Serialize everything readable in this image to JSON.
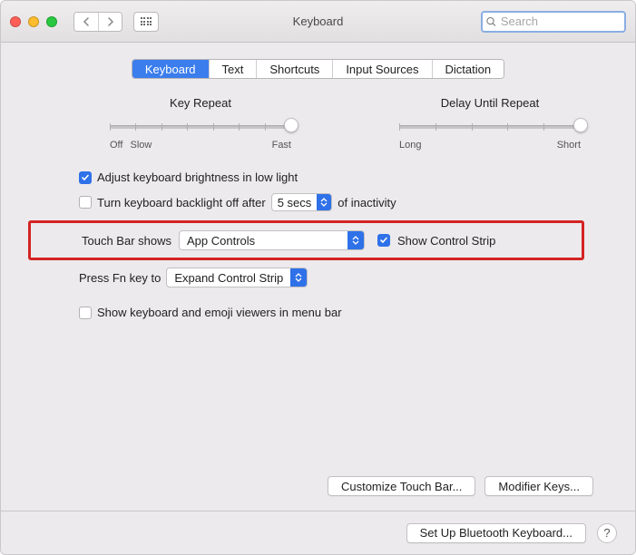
{
  "window": {
    "title": "Keyboard"
  },
  "toolbar": {
    "search_placeholder": "Search"
  },
  "tabs": [
    "Keyboard",
    "Text",
    "Shortcuts",
    "Input Sources",
    "Dictation"
  ],
  "active_tab": 0,
  "sliders": {
    "key_repeat": {
      "title": "Key Repeat",
      "left_label": "Off",
      "left_label2": "Slow",
      "right_label": "Fast",
      "ticks": 8,
      "position_pct": 100
    },
    "delay": {
      "title": "Delay Until Repeat",
      "left_label": "Long",
      "right_label": "Short",
      "ticks": 6,
      "position_pct": 100
    }
  },
  "options": {
    "auto_brightness": {
      "checked": true,
      "label": "Adjust keyboard brightness in low light"
    },
    "backlight_off": {
      "checked": false,
      "label_before": "Turn keyboard backlight off after",
      "label_after": "of inactivity",
      "value": "5 secs"
    },
    "touchbar": {
      "label": "Touch Bar shows",
      "value": "App Controls",
      "show_control_strip": {
        "checked": true,
        "label": "Show Control Strip"
      }
    },
    "fn_key": {
      "label": "Press Fn key to",
      "value": "Expand Control Strip"
    },
    "menu_bar_viewers": {
      "checked": false,
      "label": "Show keyboard and emoji viewers in menu bar"
    }
  },
  "buttons": {
    "customize_touchbar": "Customize Touch Bar...",
    "modifier_keys": "Modifier Keys...",
    "bluetooth": "Set Up Bluetooth Keyboard...",
    "help": "?"
  }
}
